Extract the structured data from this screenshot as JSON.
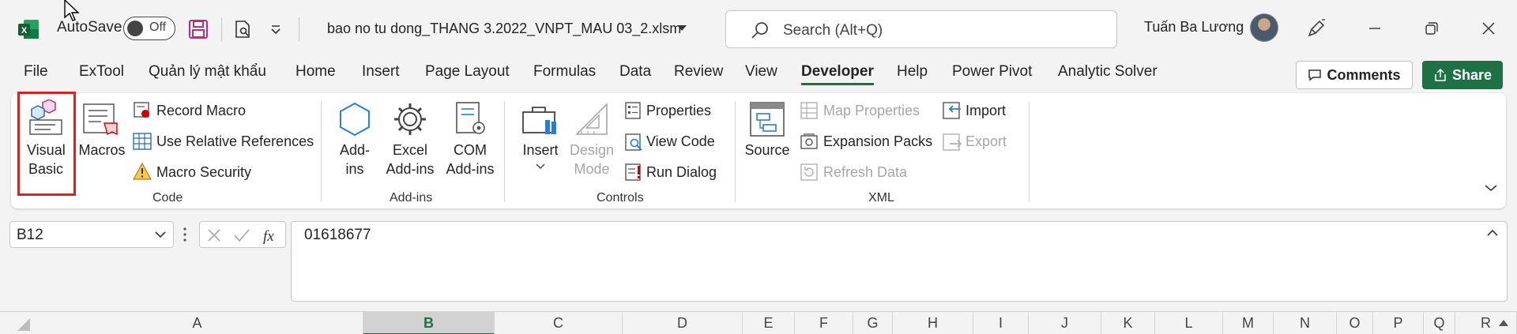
{
  "titlebar": {
    "autosave_label": "AutoSave",
    "autosave_state": "Off",
    "filename": "bao no tu  dong_THANG 3.2022_VNPT_MAU 03_2.xlsm",
    "search_placeholder": "Search (Alt+Q)",
    "username": "Tuấn Ba Lương"
  },
  "tabs": [
    {
      "label": "File"
    },
    {
      "label": "ExTool"
    },
    {
      "label": "Quản lý mật khẩu"
    },
    {
      "label": "Home"
    },
    {
      "label": "Insert"
    },
    {
      "label": "Page Layout"
    },
    {
      "label": "Formulas"
    },
    {
      "label": "Data"
    },
    {
      "label": "Review"
    },
    {
      "label": "View"
    },
    {
      "label": "Developer"
    },
    {
      "label": "Help"
    },
    {
      "label": "Power Pivot"
    },
    {
      "label": "Analytic Solver"
    }
  ],
  "actions": {
    "comments": "Comments",
    "share": "Share"
  },
  "ribbon": {
    "code": {
      "group_label": "Code",
      "visual_basic_1": "Visual",
      "visual_basic_2": "Basic",
      "macros": "Macros",
      "record_macro": "Record Macro",
      "use_relative": "Use Relative References",
      "macro_security": "Macro Security"
    },
    "addins": {
      "group_label": "Add-ins",
      "addins_1": "Add-",
      "addins_2": "ins",
      "excel_1": "Excel",
      "excel_2": "Add-ins",
      "com_1": "COM",
      "com_2": "Add-ins"
    },
    "controls": {
      "group_label": "Controls",
      "insert": "Insert",
      "design_1": "Design",
      "design_2": "Mode",
      "properties": "Properties",
      "view_code": "View Code",
      "run_dialog": "Run Dialog"
    },
    "xml": {
      "group_label": "XML",
      "source": "Source",
      "map_properties": "Map Properties",
      "expansion_packs": "Expansion Packs",
      "refresh_data": "Refresh Data",
      "import": "Import",
      "export": "Export"
    }
  },
  "formula_bar": {
    "name_box": "B12",
    "value": "01618677"
  },
  "columns": [
    "A",
    "B",
    "C",
    "D",
    "E",
    "F",
    "G",
    "H",
    "I",
    "J",
    "K",
    "L",
    "M",
    "N",
    "O",
    "P",
    "Q",
    "R"
  ],
  "colors": {
    "accent": "#1e7145",
    "highlight": "#e01f1f"
  }
}
